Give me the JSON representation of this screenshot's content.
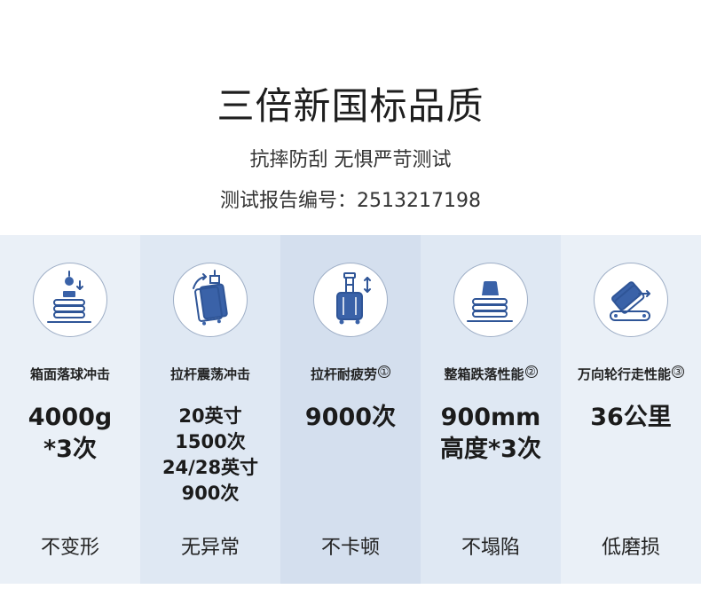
{
  "header": {
    "title": "三倍新国标品质",
    "subtitle": "抗摔防刮 无惧严苛测试",
    "report": "测试报告编号：2513217198"
  },
  "colors": {
    "col_bg": [
      "#eaf0f7",
      "#dfe8f3",
      "#d4dfee",
      "#dfe8f3",
      "#eaf0f7"
    ],
    "icon_blue": "#2f5597"
  },
  "columns": [
    {
      "icon": "drop-weight-icon",
      "name": "箱面落球冲击",
      "note": "",
      "value_lines": [
        "4000g",
        "*3次"
      ],
      "result": "不变形"
    },
    {
      "icon": "luggage-shake-icon",
      "name": "拉杆震荡冲击",
      "note": "",
      "value_lines": [
        "20英寸",
        "1500次",
        "24/28英寸",
        "900次"
      ],
      "result": "无异常"
    },
    {
      "icon": "trolley-handle-icon",
      "name": "拉杆耐疲劳",
      "note": "①",
      "value_lines": [
        "9000次"
      ],
      "result": "不卡顿"
    },
    {
      "icon": "box-drop-icon",
      "name": "整箱跌落性能",
      "note": "②",
      "value_lines": [
        "900mm",
        "高度*3次"
      ],
      "result": "不塌陷"
    },
    {
      "icon": "wheel-conveyor-icon",
      "name": "万向轮行走性能",
      "note": "③",
      "value_lines": [
        "36公里"
      ],
      "result": "低磨损"
    }
  ]
}
